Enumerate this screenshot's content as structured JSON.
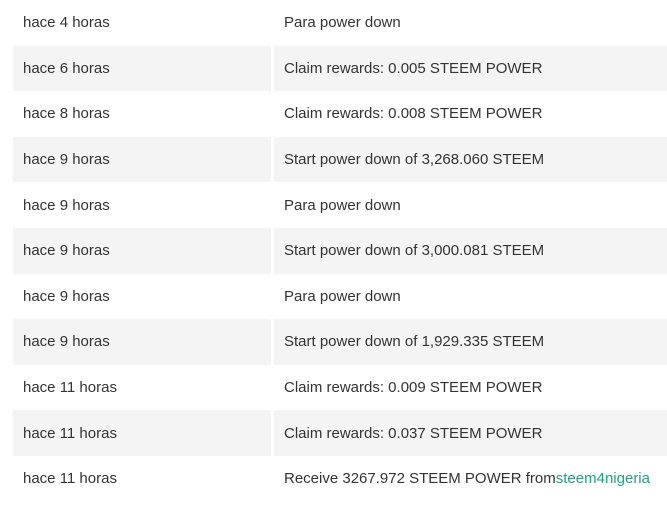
{
  "history": {
    "rows": [
      {
        "time": "hace 4 horas",
        "text": "Para power down",
        "link": ""
      },
      {
        "time": "hace 6 horas",
        "text": "Claim rewards: 0.005 STEEM POWER",
        "link": ""
      },
      {
        "time": "hace 8 horas",
        "text": "Claim rewards: 0.008 STEEM POWER",
        "link": ""
      },
      {
        "time": "hace 9 horas",
        "text": "Start power down of 3,268.060 STEEM",
        "link": ""
      },
      {
        "time": "hace 9 horas",
        "text": "Para power down",
        "link": ""
      },
      {
        "time": "hace 9 horas",
        "text": "Start power down of 3,000.081 STEEM",
        "link": ""
      },
      {
        "time": "hace 9 horas",
        "text": "Para power down",
        "link": ""
      },
      {
        "time": "hace 9 horas",
        "text": "Start power down of 1,929.335 STEEM",
        "link": ""
      },
      {
        "time": "hace 11 horas",
        "text": "Claim rewards: 0.009 STEEM POWER",
        "link": ""
      },
      {
        "time": "hace 11 horas",
        "text": "Claim rewards: 0.037 STEEM POWER",
        "link": ""
      },
      {
        "time": "hace 11 horas",
        "text": "Receive 3267.972 STEEM POWER from ",
        "link": "steem4nigeria"
      }
    ]
  },
  "colors": {
    "shaded_row": "#f4f4f4",
    "link": "#1fa37a",
    "text": "#333333"
  }
}
